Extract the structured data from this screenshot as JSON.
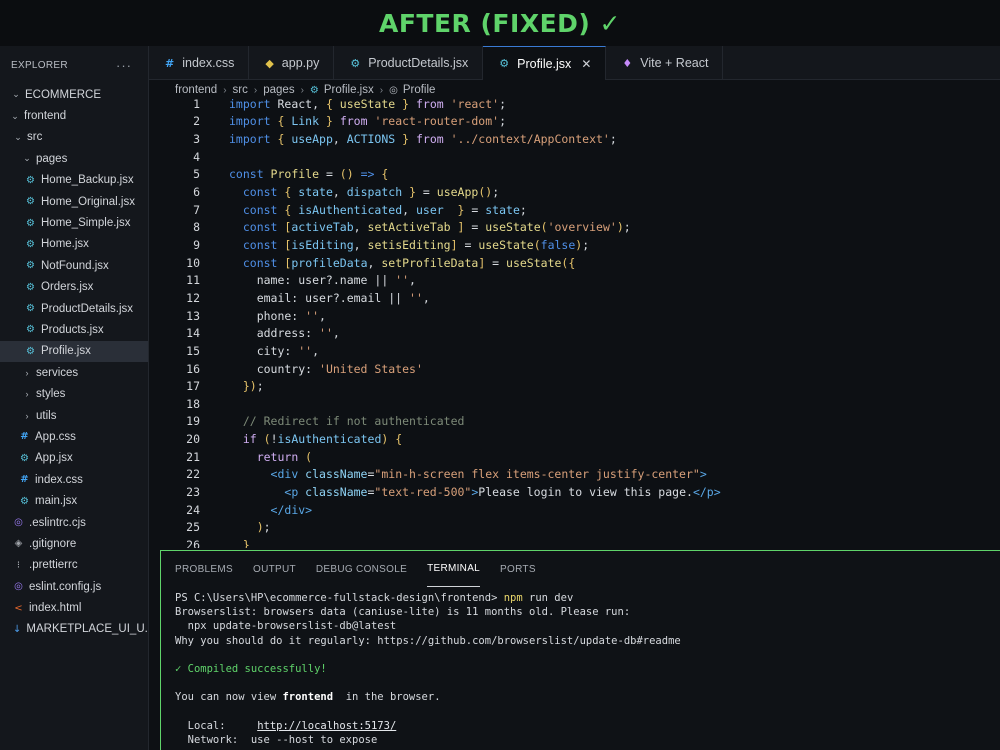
{
  "banner": {
    "text": "AFTER (FIXED) ✓"
  },
  "colors": {
    "accent_green": "#5fd36a",
    "active_tab_border": "#3a7bd5",
    "keyword_blue": "#4f8fe6",
    "string_orange": "#d8a07a"
  },
  "sidebar": {
    "title": "EXPLORER",
    "more": "···",
    "items": [
      {
        "label": "ECOMMERCE",
        "depth": 0,
        "chev": "⌄",
        "icon": ""
      },
      {
        "label": "frontend",
        "depth": 1,
        "chev": "⌄",
        "icon": ""
      },
      {
        "label": "src",
        "depth": 2,
        "chev": "⌄",
        "icon": ""
      },
      {
        "label": "pages",
        "depth": 3,
        "chev": "⌄",
        "icon": ""
      },
      {
        "label": "Home_Backup.jsx",
        "depth": 4,
        "chev": "",
        "icon": "react-icon"
      },
      {
        "label": "Home_Original.jsx",
        "depth": 4,
        "chev": "",
        "icon": "react-icon"
      },
      {
        "label": "Home_Simple.jsx",
        "depth": 4,
        "chev": "",
        "icon": "react-icon"
      },
      {
        "label": "Home.jsx",
        "depth": 4,
        "chev": "",
        "icon": "react-icon"
      },
      {
        "label": "NotFound.jsx",
        "depth": 4,
        "chev": "",
        "icon": "react-icon"
      },
      {
        "label": "Orders.jsx",
        "depth": 4,
        "chev": "",
        "icon": "react-icon"
      },
      {
        "label": "ProductDetails.jsx",
        "depth": 4,
        "chev": "",
        "icon": "react-icon"
      },
      {
        "label": "Products.jsx",
        "depth": 4,
        "chev": "",
        "icon": "react-icon"
      },
      {
        "label": "Profile.jsx",
        "depth": 4,
        "chev": "",
        "icon": "react-icon",
        "active": true
      },
      {
        "label": "services",
        "depth": 3,
        "chev": "›",
        "icon": ""
      },
      {
        "label": "styles",
        "depth": 3,
        "chev": "›",
        "icon": ""
      },
      {
        "label": "utils",
        "depth": 3,
        "chev": "›",
        "icon": ""
      },
      {
        "label": "App.css",
        "depth": 3,
        "chev": "",
        "icon": "css-icon"
      },
      {
        "label": "App.jsx",
        "depth": 3,
        "chev": "",
        "icon": "react-icon"
      },
      {
        "label": "index.css",
        "depth": 3,
        "chev": "",
        "icon": "css-icon"
      },
      {
        "label": "main.jsx",
        "depth": 3,
        "chev": "",
        "icon": "react-icon"
      },
      {
        "label": ".eslintrc.cjs",
        "depth": 2,
        "chev": "",
        "icon": "eslint-icon"
      },
      {
        "label": ".gitignore",
        "depth": 2,
        "chev": "",
        "icon": "git-icon"
      },
      {
        "label": ".prettierrc",
        "depth": 2,
        "chev": "",
        "icon": "prettier-icon"
      },
      {
        "label": "eslint.config.js",
        "depth": 2,
        "chev": "",
        "icon": "eslint-icon"
      },
      {
        "label": "index.html",
        "depth": 2,
        "chev": "",
        "icon": "html-icon"
      },
      {
        "label": "MARKETPLACE_UI_U...",
        "depth": 2,
        "chev": "",
        "icon": "markdown-icon"
      }
    ]
  },
  "tabs": [
    {
      "label": "index.css",
      "icon": "css-icon",
      "active": false
    },
    {
      "label": "app.py",
      "icon": "python-icon",
      "active": false
    },
    {
      "label": "ProductDetails.jsx",
      "icon": "react-icon",
      "active": false
    },
    {
      "label": "Profile.jsx",
      "icon": "react-icon",
      "active": true,
      "close": "✕"
    },
    {
      "label": "Vite + React",
      "icon": "vite-icon",
      "active": false
    }
  ],
  "breadcrumb": [
    "frontend",
    "src",
    "pages",
    "Profile.jsx",
    "Profile"
  ],
  "editor": {
    "lines": [
      [
        [
          "kw",
          "import "
        ],
        [
          "txt",
          "React, "
        ],
        [
          "pun",
          "{ "
        ],
        [
          "fn",
          "useState"
        ],
        [
          "pun",
          " }"
        ],
        [
          "kwc",
          " from "
        ],
        [
          "str",
          "'react'"
        ],
        [
          "txt",
          ";"
        ]
      ],
      [
        [
          "kw",
          "import "
        ],
        [
          "pun",
          "{ "
        ],
        [
          "var",
          "Link"
        ],
        [
          "pun",
          " }"
        ],
        [
          "kwc",
          " from "
        ],
        [
          "str",
          "'react-router-dom'"
        ],
        [
          "txt",
          ";"
        ]
      ],
      [
        [
          "kw",
          "import "
        ],
        [
          "pun",
          "{ "
        ],
        [
          "var",
          "useApp"
        ],
        [
          "txt",
          ", "
        ],
        [
          "var",
          "ACTIONS"
        ],
        [
          "pun",
          " }"
        ],
        [
          "kwc",
          " from "
        ],
        [
          "str",
          "'../context/AppContext'"
        ],
        [
          "txt",
          ";"
        ]
      ],
      [],
      [
        [
          "kw",
          "const "
        ],
        [
          "fn",
          "Profile"
        ],
        [
          "txt",
          " = "
        ],
        [
          "pun",
          "()"
        ],
        [
          "txt",
          " "
        ],
        [
          "kw",
          "=>"
        ],
        [
          "txt",
          " "
        ],
        [
          "pun",
          "{"
        ]
      ],
      [
        [
          "txt",
          "  "
        ],
        [
          "kw",
          "const "
        ],
        [
          "pun",
          "{ "
        ],
        [
          "var",
          "state"
        ],
        [
          "txt",
          ", "
        ],
        [
          "var",
          "dispatch"
        ],
        [
          "pun",
          " }"
        ],
        [
          "txt",
          " = "
        ],
        [
          "fn",
          "useApp"
        ],
        [
          "pun",
          "()"
        ],
        [
          "txt",
          ";"
        ]
      ],
      [
        [
          "txt",
          "  "
        ],
        [
          "kw",
          "const "
        ],
        [
          "pun",
          "{ "
        ],
        [
          "var",
          "isAuthenticated"
        ],
        [
          "txt",
          ", "
        ],
        [
          "var",
          "user"
        ],
        [
          "pun",
          "  }"
        ],
        [
          "txt",
          " = "
        ],
        [
          "var",
          "state"
        ],
        [
          "txt",
          ";"
        ]
      ],
      [
        [
          "txt",
          "  "
        ],
        [
          "kw",
          "const "
        ],
        [
          "pun",
          "["
        ],
        [
          "var",
          "activeTab"
        ],
        [
          "txt",
          ", "
        ],
        [
          "fn",
          "setActiveTab"
        ],
        [
          "pun",
          " ]"
        ],
        [
          "txt",
          " = "
        ],
        [
          "fn",
          "useState"
        ],
        [
          "pun",
          "("
        ],
        [
          "str",
          "'overview'"
        ],
        [
          "pun",
          ")"
        ],
        [
          "txt",
          ";"
        ]
      ],
      [
        [
          "txt",
          "  "
        ],
        [
          "kw",
          "const "
        ],
        [
          "pun",
          "["
        ],
        [
          "var",
          "isEditing"
        ],
        [
          "txt",
          ", "
        ],
        [
          "fn",
          "setisEditing"
        ],
        [
          "pun",
          "]"
        ],
        [
          "txt",
          " = "
        ],
        [
          "fn",
          "useState"
        ],
        [
          "pun",
          "("
        ],
        [
          "kw",
          "false"
        ],
        [
          "pun",
          ")"
        ],
        [
          "txt",
          ";"
        ]
      ],
      [
        [
          "txt",
          "  "
        ],
        [
          "kw",
          "const "
        ],
        [
          "pun",
          "["
        ],
        [
          "var",
          "profileData"
        ],
        [
          "txt",
          ", "
        ],
        [
          "fn",
          "setProfileData"
        ],
        [
          "pun",
          "]"
        ],
        [
          "txt",
          " = "
        ],
        [
          "fn",
          "useState"
        ],
        [
          "pun",
          "({"
        ]
      ],
      [
        [
          "txt",
          "    name: user?.name || "
        ],
        [
          "str",
          "''"
        ],
        [
          "txt",
          ","
        ]
      ],
      [
        [
          "txt",
          "    email: user?.email || "
        ],
        [
          "str",
          "''"
        ],
        [
          "txt",
          ","
        ]
      ],
      [
        [
          "txt",
          "    phone: "
        ],
        [
          "str",
          "''"
        ],
        [
          "txt",
          ","
        ]
      ],
      [
        [
          "txt",
          "    address: "
        ],
        [
          "str",
          "''"
        ],
        [
          "txt",
          ","
        ]
      ],
      [
        [
          "txt",
          "    city: "
        ],
        [
          "str",
          "''"
        ],
        [
          "txt",
          ","
        ]
      ],
      [
        [
          "txt",
          "    country: "
        ],
        [
          "str",
          "'United States'"
        ]
      ],
      [
        [
          "txt",
          "  "
        ],
        [
          "pun",
          "})"
        ],
        [
          "txt",
          ";"
        ]
      ],
      [],
      [
        [
          "txt",
          "  "
        ],
        [
          "cm",
          "// Redirect if not authenticated"
        ]
      ],
      [
        [
          "txt",
          "  "
        ],
        [
          "kwc",
          "if "
        ],
        [
          "pun",
          "("
        ],
        [
          "txt",
          "!"
        ],
        [
          "var",
          "isAuthenticated"
        ],
        [
          "pun",
          ")"
        ],
        [
          "txt",
          " "
        ],
        [
          "pun",
          "{"
        ]
      ],
      [
        [
          "txt",
          "    "
        ],
        [
          "kwc",
          "return "
        ],
        [
          "pun",
          "("
        ]
      ],
      [
        [
          "txt",
          "      "
        ],
        [
          "tag",
          "<div "
        ],
        [
          "attr",
          "className"
        ],
        [
          "txt",
          "="
        ],
        [
          "str",
          "\"min-h-screen flex items-center justify-center\""
        ],
        [
          "tag",
          ">"
        ]
      ],
      [
        [
          "txt",
          "        "
        ],
        [
          "tag",
          "<p "
        ],
        [
          "attr",
          "className"
        ],
        [
          "txt",
          "="
        ],
        [
          "str",
          "\"text-red-500\""
        ],
        [
          "tag",
          ">"
        ],
        [
          "txt",
          "Please login to view this page."
        ],
        [
          "tag",
          "</p>"
        ]
      ],
      [
        [
          "txt",
          "      "
        ],
        [
          "tag",
          "</div>"
        ]
      ],
      [
        [
          "txt",
          "    "
        ],
        [
          "pun",
          ")"
        ],
        [
          "txt",
          ";"
        ]
      ],
      [
        [
          "txt",
          "  "
        ],
        [
          "pun",
          "}"
        ]
      ]
    ]
  },
  "panel": {
    "tabs": [
      {
        "label": "PROBLEMS",
        "active": false
      },
      {
        "label": "OUTPUT",
        "active": false
      },
      {
        "label": "DEBUG CONSOLE",
        "active": false
      },
      {
        "label": "TERMINAL",
        "active": true
      },
      {
        "label": "PORTS",
        "active": false
      }
    ],
    "terminal": [
      [
        [
          "plain",
          "PS C:\\Users\\HP\\ecommerce-fullstack-design\\frontend> "
        ],
        [
          "cmd",
          "npm"
        ],
        [
          "plain",
          " run dev"
        ]
      ],
      [
        [
          "plain",
          "Browserslist: browsers data (caniuse-lite) is 11 months old. Please run:"
        ]
      ],
      [
        [
          "plain",
          "  npx update-browserslist-db@latest"
        ]
      ],
      [
        [
          "plain",
          "Why you should do it regularly: https://github.com/browserslist/update-db#readme"
        ]
      ],
      [],
      [
        [
          "ok",
          "✓ Compiled successfully!"
        ]
      ],
      [],
      [
        [
          "plain",
          "You can now view "
        ],
        [
          "bold",
          "frontend"
        ],
        [
          "plain",
          "  in the browser."
        ]
      ],
      [],
      [
        [
          "plain",
          "  Local:     "
        ],
        [
          "url",
          "http://localhost:5173/"
        ]
      ],
      [
        [
          "plain",
          "  Network:  use --host to expose"
        ]
      ]
    ]
  }
}
